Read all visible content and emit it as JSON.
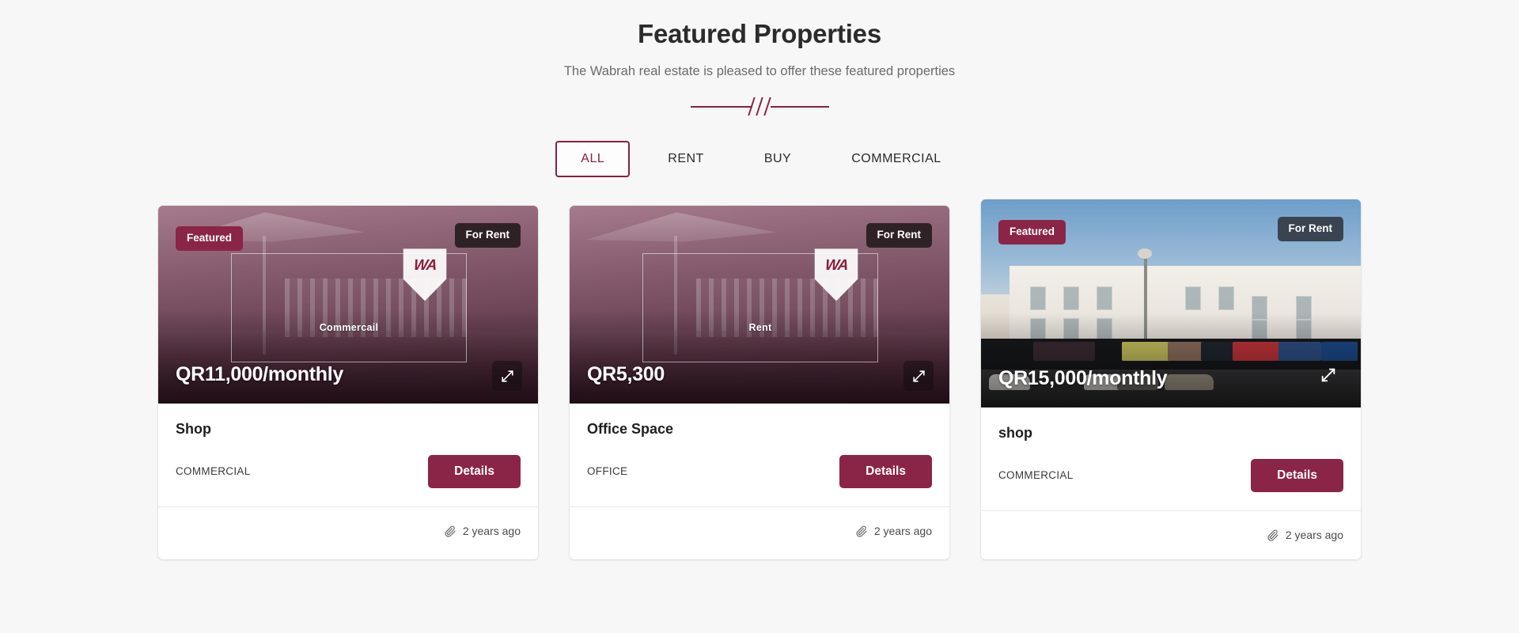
{
  "header": {
    "title": "Featured Properties",
    "subtitle": "The Wabrah real estate is pleased to offer these featured properties"
  },
  "colors": {
    "brand_maroon": "#8a1f3e",
    "badge_featured": "#8a2547",
    "badge_status_dark": "#2f2226",
    "badge_status_slate": "#3a4450",
    "details_button": "#8a2547",
    "page_background": "#f7f7f8"
  },
  "filters": {
    "tabs": [
      {
        "label": "ALL",
        "active": true
      },
      {
        "label": "RENT",
        "active": false
      },
      {
        "label": "BUY",
        "active": false
      },
      {
        "label": "COMMERCIAL",
        "active": false
      }
    ]
  },
  "cards": [
    {
      "featured_badge": "Featured",
      "status_badge": "For Rent",
      "watermark_label": "Commercail",
      "logo_mark": "WA",
      "price": "QR11,000/monthly",
      "title": "Shop",
      "type": "COMMERCIAL",
      "details_label": "Details",
      "time_ago": "2 years ago",
      "expand_icon": "expand-arrows-icon",
      "attachment_icon": "paperclip-icon"
    },
    {
      "featured_badge": "",
      "status_badge": "For Rent",
      "watermark_label": "Rent",
      "logo_mark": "WA",
      "price": "QR5,300",
      "title": "Office Space",
      "type": "OFFICE",
      "details_label": "Details",
      "time_ago": "2 years ago",
      "expand_icon": "expand-arrows-icon",
      "attachment_icon": "paperclip-icon"
    },
    {
      "featured_badge": "Featured",
      "status_badge": "For Rent",
      "watermark_label": "",
      "logo_mark": "",
      "price": "QR15,000/monthly",
      "title": "shop",
      "type": "COMMERCIAL",
      "details_label": "Details",
      "time_ago": "2 years ago",
      "expand_icon": "expand-arrows-icon",
      "attachment_icon": "paperclip-icon"
    }
  ]
}
